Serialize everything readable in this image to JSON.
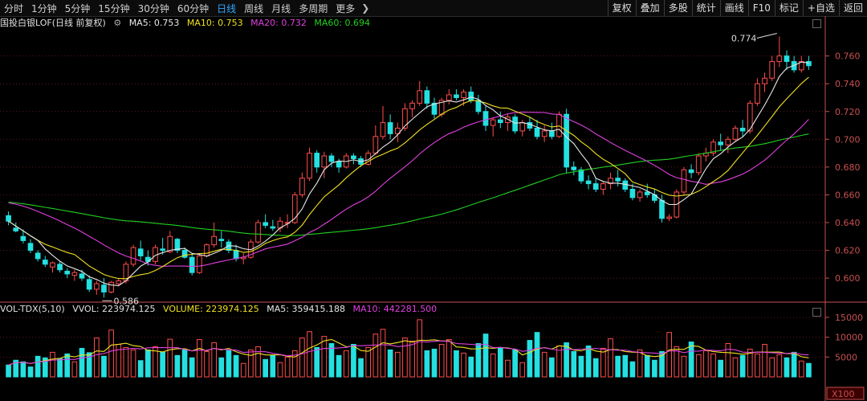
{
  "toolbar": {
    "periods": [
      "分时",
      "1分钟",
      "5分钟",
      "15分钟",
      "30分钟",
      "60分钟",
      "日线",
      "周线",
      "月线",
      "多周期",
      "更多"
    ],
    "active_period": "日线",
    "tools": [
      "复权",
      "叠加",
      "多股",
      "统计",
      "画线",
      "F10",
      "标记",
      "+自选",
      "返回"
    ]
  },
  "price_panel": {
    "title": "国投白银LOF(日线 前复权)",
    "ma5": "MA5: 0.753",
    "ma10": "MA10: 0.753",
    "ma20": "MA20: 0.732",
    "ma60": "MA60: 0.694",
    "y_ticks": [
      "0.760",
      "0.740",
      "0.720",
      "0.700",
      "0.680",
      "0.660",
      "0.640",
      "0.620",
      "0.600"
    ],
    "high_label": "0.774",
    "low_label": "0.586"
  },
  "volume_panel": {
    "title": "VOL-TDX(5,10)",
    "vvol": "VVOL: 223974.125",
    "volume": "VOLUME: 223974.125",
    "ma5": "MA5: 359415.188",
    "ma10": "MA10: 442281.500",
    "y_ticks": [
      "15000",
      "10000",
      "5000"
    ],
    "unit": "X100"
  },
  "colors": {
    "up": "#ff4d4d",
    "down": "#24e0e0",
    "ma5": "#e8e8e8",
    "ma10": "#f0e020",
    "ma20": "#e040e0",
    "ma60": "#20d020",
    "axis": "#c85050"
  },
  "chart_data": {
    "type": "candlestick",
    "title": "国投白银LOF(日线 前复权)",
    "ylim": [
      0.585,
      0.776
    ],
    "candles_ohlc": [
      [
        0.645,
        0.648,
        0.638,
        0.641
      ],
      [
        0.636,
        0.64,
        0.633,
        0.634
      ],
      [
        0.63,
        0.635,
        0.625,
        0.627
      ],
      [
        0.625,
        0.628,
        0.618,
        0.62
      ],
      [
        0.618,
        0.62,
        0.612,
        0.614
      ],
      [
        0.613,
        0.616,
        0.608,
        0.61
      ],
      [
        0.608,
        0.612,
        0.604,
        0.611
      ],
      [
        0.61,
        0.612,
        0.604,
        0.606
      ],
      [
        0.605,
        0.607,
        0.6,
        0.603
      ],
      [
        0.602,
        0.606,
        0.598,
        0.604
      ],
      [
        0.603,
        0.606,
        0.598,
        0.6
      ],
      [
        0.599,
        0.602,
        0.59,
        0.592
      ],
      [
        0.592,
        0.598,
        0.588,
        0.596
      ],
      [
        0.595,
        0.6,
        0.586,
        0.59
      ],
      [
        0.59,
        0.598,
        0.589,
        0.597
      ],
      [
        0.596,
        0.6,
        0.594,
        0.598
      ],
      [
        0.598,
        0.612,
        0.596,
        0.61
      ],
      [
        0.61,
        0.624,
        0.608,
        0.622
      ],
      [
        0.621,
        0.627,
        0.613,
        0.616
      ],
      [
        0.615,
        0.62,
        0.609,
        0.612
      ],
      [
        0.612,
        0.624,
        0.61,
        0.622
      ],
      [
        0.621,
        0.629,
        0.617,
        0.62
      ],
      [
        0.619,
        0.634,
        0.618,
        0.63
      ],
      [
        0.628,
        0.629,
        0.618,
        0.62
      ],
      [
        0.62,
        0.622,
        0.614,
        0.615
      ],
      [
        0.615,
        0.617,
        0.602,
        0.604
      ],
      [
        0.604,
        0.618,
        0.603,
        0.616
      ],
      [
        0.616,
        0.625,
        0.615,
        0.624
      ],
      [
        0.624,
        0.64,
        0.622,
        0.63
      ],
      [
        0.628,
        0.634,
        0.622,
        0.627
      ],
      [
        0.626,
        0.628,
        0.618,
        0.62
      ],
      [
        0.62,
        0.624,
        0.612,
        0.614
      ],
      [
        0.614,
        0.618,
        0.61,
        0.615
      ],
      [
        0.615,
        0.628,
        0.614,
        0.626
      ],
      [
        0.626,
        0.642,
        0.625,
        0.64
      ],
      [
        0.64,
        0.646,
        0.636,
        0.638
      ],
      [
        0.637,
        0.642,
        0.634,
        0.636
      ],
      [
        0.636,
        0.644,
        0.633,
        0.641
      ],
      [
        0.64,
        0.646,
        0.636,
        0.64
      ],
      [
        0.64,
        0.662,
        0.639,
        0.66
      ],
      [
        0.66,
        0.676,
        0.658,
        0.672
      ],
      [
        0.672,
        0.694,
        0.67,
        0.69
      ],
      [
        0.69,
        0.692,
        0.676,
        0.68
      ],
      [
        0.68,
        0.691,
        0.672,
        0.688
      ],
      [
        0.688,
        0.69,
        0.68,
        0.684
      ],
      [
        0.684,
        0.686,
        0.676,
        0.68
      ],
      [
        0.68,
        0.69,
        0.679,
        0.688
      ],
      [
        0.688,
        0.69,
        0.682,
        0.686
      ],
      [
        0.686,
        0.688,
        0.68,
        0.682
      ],
      [
        0.682,
        0.692,
        0.681,
        0.69
      ],
      [
        0.69,
        0.71,
        0.689,
        0.702
      ],
      [
        0.702,
        0.724,
        0.7,
        0.712
      ],
      [
        0.712,
        0.718,
        0.7,
        0.704
      ],
      [
        0.704,
        0.712,
        0.698,
        0.708
      ],
      [
        0.708,
        0.726,
        0.706,
        0.722
      ],
      [
        0.722,
        0.728,
        0.716,
        0.726
      ],
      [
        0.726,
        0.742,
        0.724,
        0.735
      ],
      [
        0.735,
        0.738,
        0.722,
        0.726
      ],
      [
        0.726,
        0.73,
        0.715,
        0.718
      ],
      [
        0.718,
        0.73,
        0.716,
        0.728
      ],
      [
        0.728,
        0.736,
        0.725,
        0.732
      ],
      [
        0.732,
        0.736,
        0.728,
        0.73
      ],
      [
        0.73,
        0.736,
        0.724,
        0.734
      ],
      [
        0.734,
        0.738,
        0.726,
        0.728
      ],
      [
        0.728,
        0.732,
        0.718,
        0.72
      ],
      [
        0.72,
        0.724,
        0.706,
        0.71
      ],
      [
        0.71,
        0.716,
        0.702,
        0.714
      ],
      [
        0.714,
        0.72,
        0.708,
        0.712
      ],
      [
        0.712,
        0.718,
        0.706,
        0.716
      ],
      [
        0.716,
        0.718,
        0.704,
        0.706
      ],
      [
        0.706,
        0.714,
        0.702,
        0.712
      ],
      [
        0.712,
        0.716,
        0.706,
        0.708
      ],
      [
        0.708,
        0.714,
        0.7,
        0.702
      ],
      [
        0.702,
        0.71,
        0.698,
        0.706
      ],
      [
        0.706,
        0.712,
        0.7,
        0.702
      ],
      [
        0.702,
        0.72,
        0.701,
        0.718
      ],
      [
        0.718,
        0.722,
        0.676,
        0.68
      ],
      [
        0.68,
        0.684,
        0.674,
        0.678
      ],
      [
        0.678,
        0.68,
        0.668,
        0.67
      ],
      [
        0.67,
        0.674,
        0.664,
        0.668
      ],
      [
        0.668,
        0.672,
        0.662,
        0.664
      ],
      [
        0.664,
        0.67,
        0.66,
        0.668
      ],
      [
        0.668,
        0.676,
        0.664,
        0.672
      ],
      [
        0.672,
        0.678,
        0.666,
        0.67
      ],
      [
        0.67,
        0.672,
        0.662,
        0.664
      ],
      [
        0.664,
        0.668,
        0.656,
        0.658
      ],
      [
        0.658,
        0.664,
        0.655,
        0.662
      ],
      [
        0.662,
        0.668,
        0.658,
        0.66
      ],
      [
        0.66,
        0.664,
        0.654,
        0.656
      ],
      [
        0.656,
        0.66,
        0.64,
        0.643
      ],
      [
        0.643,
        0.646,
        0.641,
        0.644
      ],
      [
        0.644,
        0.664,
        0.643,
        0.662
      ],
      [
        0.662,
        0.68,
        0.66,
        0.678
      ],
      [
        0.678,
        0.682,
        0.672,
        0.676
      ],
      [
        0.676,
        0.69,
        0.674,
        0.688
      ],
      [
        0.688,
        0.694,
        0.684,
        0.69
      ],
      [
        0.69,
        0.7,
        0.688,
        0.698
      ],
      [
        0.698,
        0.704,
        0.692,
        0.696
      ],
      [
        0.696,
        0.702,
        0.69,
        0.7
      ],
      [
        0.7,
        0.71,
        0.698,
        0.708
      ],
      [
        0.708,
        0.714,
        0.702,
        0.706
      ],
      [
        0.706,
        0.728,
        0.704,
        0.726
      ],
      [
        0.726,
        0.744,
        0.724,
        0.74
      ],
      [
        0.74,
        0.748,
        0.734,
        0.744
      ],
      [
        0.744,
        0.76,
        0.742,
        0.756
      ],
      [
        0.756,
        0.774,
        0.752,
        0.76
      ],
      [
        0.76,
        0.764,
        0.75,
        0.756
      ],
      [
        0.756,
        0.76,
        0.748,
        0.75
      ],
      [
        0.75,
        0.76,
        0.748,
        0.756
      ],
      [
        0.756,
        0.76,
        0.75,
        0.753
      ]
    ],
    "volume_x100": [
      3000,
      4200,
      3800,
      2500,
      5200,
      4800,
      6200,
      4600,
      5800,
      3800,
      7200,
      6100,
      9800,
      5200,
      11800,
      8200,
      7400,
      6800,
      4100,
      6800,
      7600,
      6200,
      9500,
      5400,
      6800,
      4800,
      9400,
      6400,
      8600,
      4800,
      6600,
      5400,
      3400,
      6800,
      7600,
      4400,
      5400,
      3600,
      5000,
      6600,
      9800,
      11400,
      7400,
      10200,
      8400,
      5400,
      6600,
      8200,
      4600,
      7400,
      10800,
      12000,
      6800,
      6200,
      9800,
      9000,
      14400,
      6600,
      7000,
      8200,
      9400,
      6600,
      6000,
      5000,
      8400,
      10800,
      5800,
      7200,
      4200,
      6800,
      3600,
      9200,
      11200,
      6200,
      4800,
      7800,
      8600,
      6400,
      5200,
      7800,
      4600,
      7200,
      9600,
      5200,
      5400,
      3800,
      6800,
      5400,
      4200,
      6400,
      11200,
      7600,
      5200,
      8800,
      5600,
      6600,
      5800,
      4200,
      8400,
      4800,
      5400,
      7000,
      5800,
      8200,
      4800,
      5600,
      4800,
      6200,
      4000,
      3400
    ]
  }
}
